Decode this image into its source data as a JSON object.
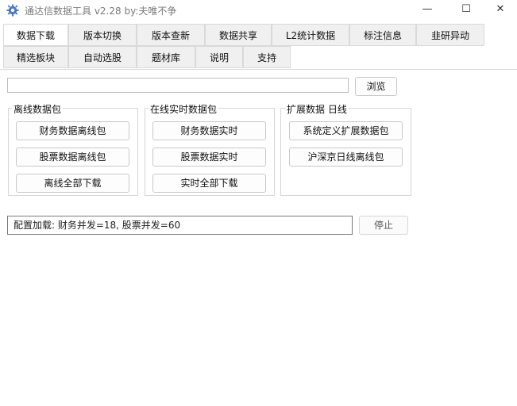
{
  "window": {
    "title": "通达信数据工具 v2.28 by:夫唯不争",
    "icon": "gear-icon",
    "controls": {
      "minimize": "—",
      "maximize": "☐",
      "close": "✕"
    }
  },
  "tabs_row1": [
    "数据下载",
    "版本切换",
    "版本查新",
    "数据共享",
    "L2统计数据",
    "标注信息",
    "韭研异动"
  ],
  "tabs_row2": [
    "精选板块",
    "自动选股",
    "题材库",
    "说明",
    "支持"
  ],
  "active_tab": "数据下载",
  "path": {
    "value": "",
    "browse_label": "浏览"
  },
  "groups": {
    "offline": {
      "title": "离线数据包",
      "buttons": [
        "财务数据离线包",
        "股票数据离线包",
        "离线全部下载"
      ]
    },
    "realtime": {
      "title": "在线实时数据包",
      "buttons": [
        "财务数据实时",
        "股票数据实时",
        "实时全部下载"
      ]
    },
    "extended": {
      "title": "扩展数据 日线",
      "buttons": [
        "系统定义扩展数据包",
        "沪深京日线离线包"
      ]
    }
  },
  "status": {
    "text": "配置加载: 财务并发=18, 股票并发=60",
    "stop_label": "停止"
  }
}
